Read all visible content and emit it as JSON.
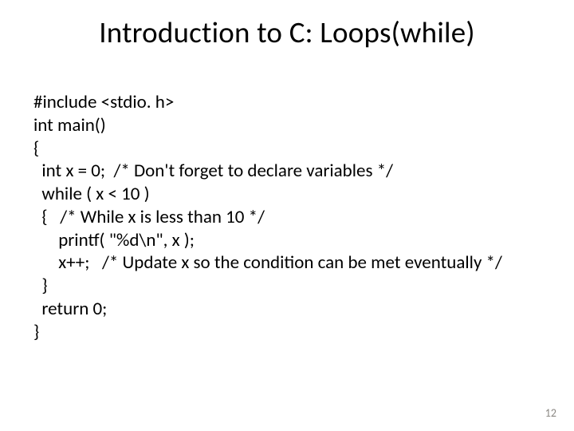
{
  "title": "Introduction to C: Loops(while)",
  "code": {
    "l1": "#include <stdio. h>",
    "l2": "int main()",
    "l3": "{",
    "l4": "  int x = 0;  /* Don't forget to declare variables */",
    "l5": "  while ( x < 10 )",
    "l6": "  {   /* While x is less than 10 */",
    "l7": "      printf( \"%d\\n\", x );",
    "l8": "      x++;   /* Update x so the condition can be met eventually */",
    "l9": "  }",
    "l10": "  return 0;",
    "l11": "}"
  },
  "page_number": "12"
}
